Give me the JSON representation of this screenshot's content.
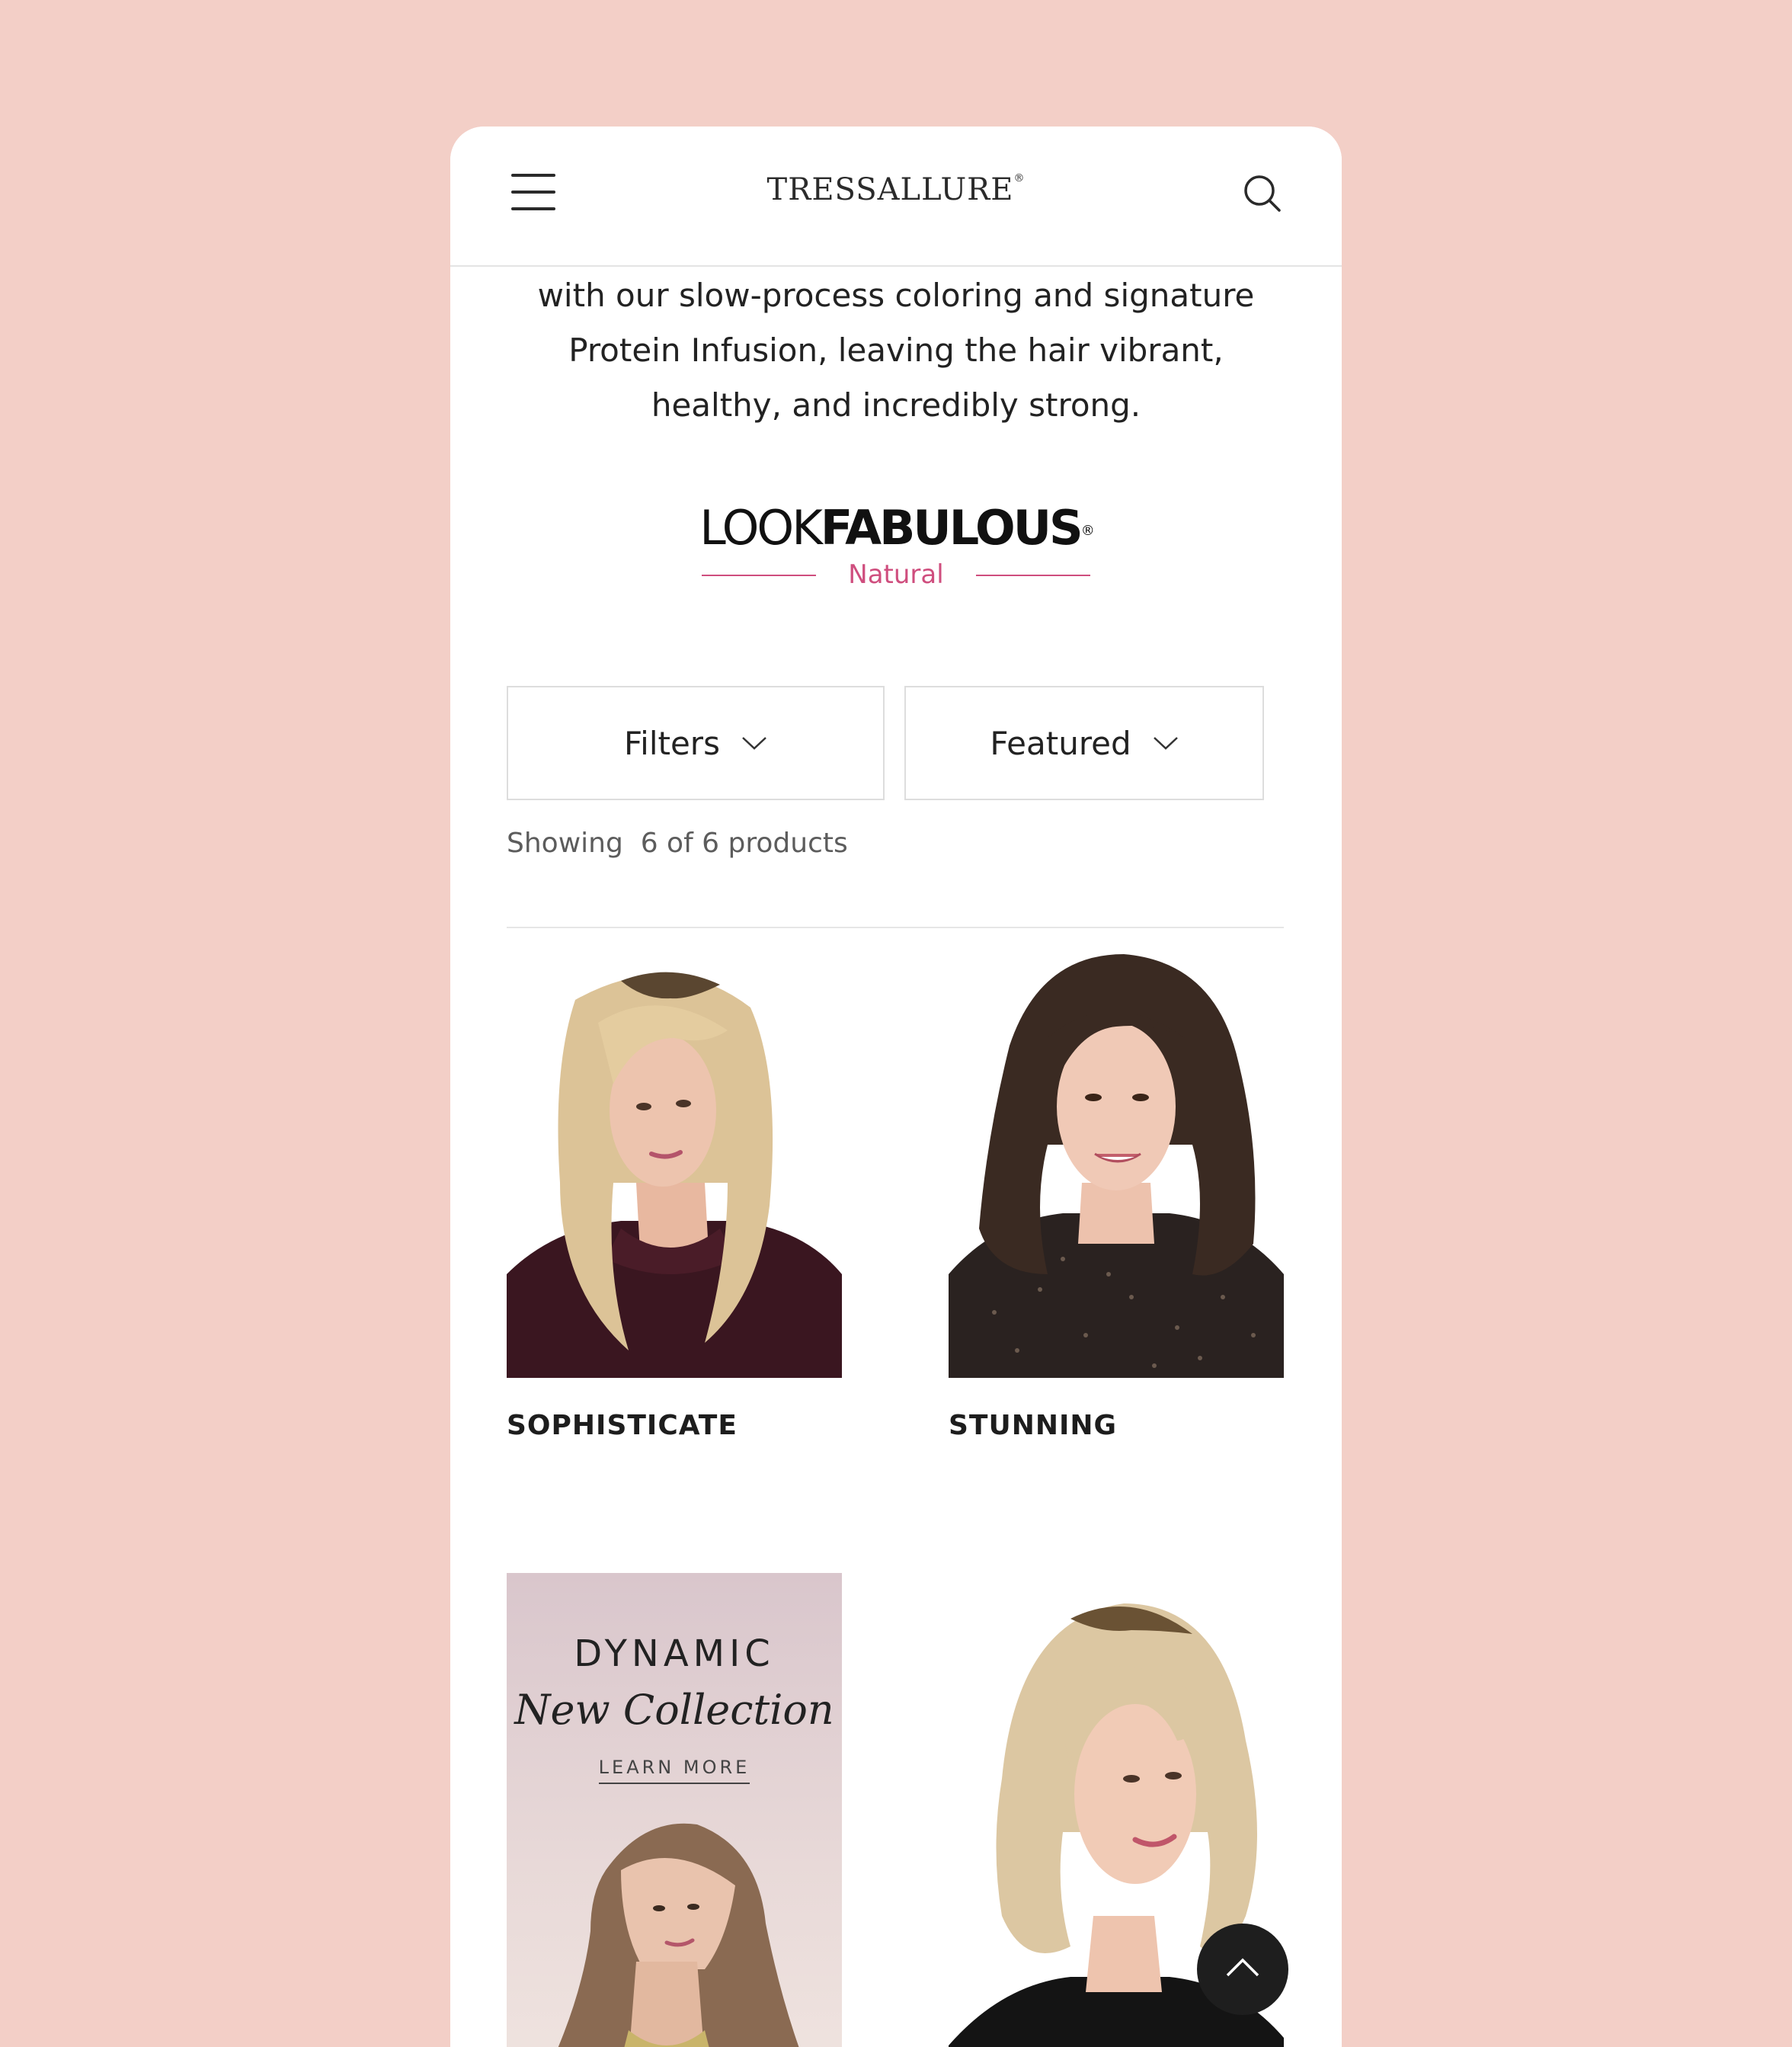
{
  "header": {
    "brand": "TRESSALLURE",
    "brand_mark": "®"
  },
  "intro": {
    "text": "with our slow-process coloring and signature Protein Infusion, leaving the hair vibrant, healthy, and incredibly strong."
  },
  "collection_logo": {
    "part1": "LOOK",
    "part2": "FABULOUS",
    "reg": "®",
    "sub": "Natural",
    "accent_color": "#cf4e7e"
  },
  "controls": {
    "filters_label": "Filters",
    "sort_label": "Featured"
  },
  "results": {
    "count_text": "Showing  6 of 6 products"
  },
  "products": [
    {
      "name": "SOPHISTICATE",
      "hair": "blonde"
    },
    {
      "name": "STUNNING",
      "hair": "brunette"
    },
    {
      "name": "",
      "hair": "blonde"
    }
  ],
  "promo": {
    "title": "DYNAMIC",
    "subtitle": "New Collection",
    "link": "LEARN MORE"
  },
  "colors": {
    "background": "#f3cfc7",
    "text": "#222222"
  }
}
